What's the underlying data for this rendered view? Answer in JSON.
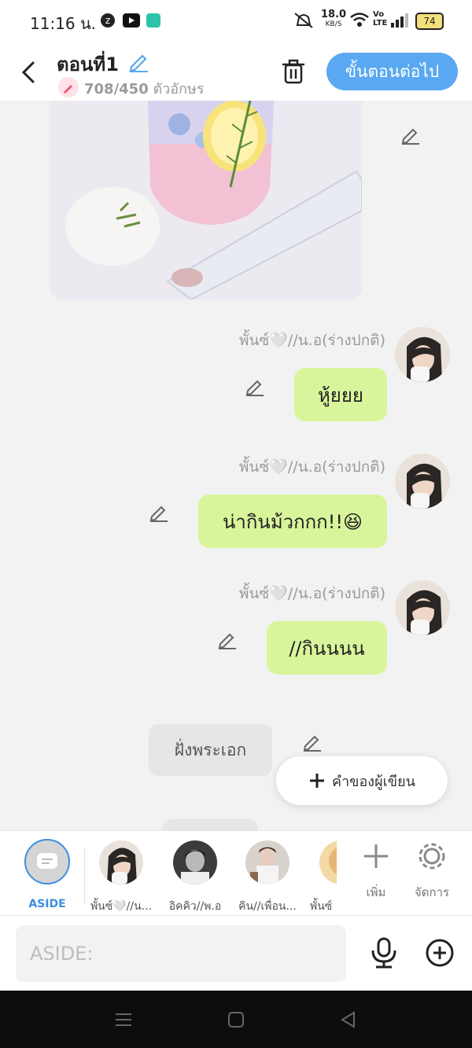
{
  "status": {
    "time": "11:16 น.",
    "net_speed_top": "18.0",
    "net_speed_bottom": "KB/S",
    "volte_top": "Vo",
    "volte_bottom": "LTE",
    "battery": "74"
  },
  "header": {
    "title": "ตอนที่1",
    "char_count": "708/450",
    "char_count_unit": "ตัวอักษร",
    "next_label": "ขั้นตอนต่อไป"
  },
  "messages": [
    {
      "name": "พั้นซ์🤍//น.อ(ร่างปกติ)",
      "text": "หู้ยยย"
    },
    {
      "name": "พั้นซ์🤍//น.อ(ร่างปกติ)",
      "text": "น่ากินม้วกกก!!😆"
    },
    {
      "name": "พั้นซ์🤍//น.อ(ร่างปกติ)",
      "text": "//กินนนน"
    }
  ],
  "aside_message": "ฝั่งพระเอก",
  "author_button": "คำของผู้เขียน",
  "characters": [
    {
      "label": "ASIDE"
    },
    {
      "label": "พั้นซ์🤍//น..."
    },
    {
      "label": "อิคคิว//พ.อ"
    },
    {
      "label": "คิน//เพื่อน..."
    },
    {
      "label": "พั้นซ์"
    }
  ],
  "char_actions": {
    "add": "เพิ่ม",
    "manage": "จัดการ"
  },
  "input": {
    "placeholder": "ASIDE:"
  },
  "colors": {
    "accent": "#5aa8f2",
    "bubble": "#d8f59b",
    "aside_active": "#3b8fe0"
  }
}
